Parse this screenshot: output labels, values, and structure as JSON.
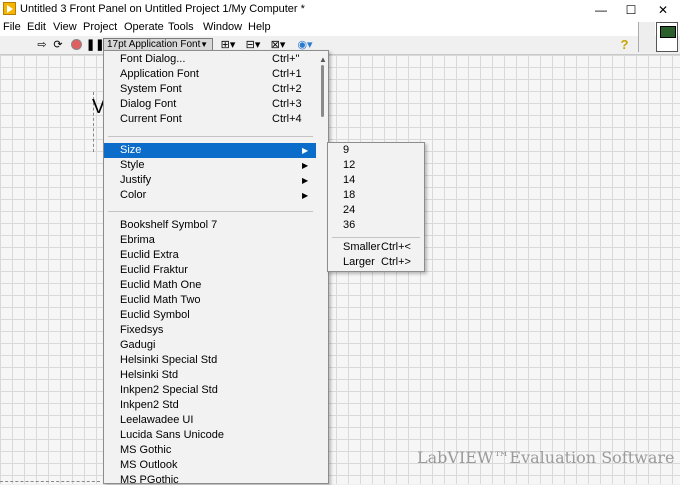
{
  "window": {
    "title": "Untitled 3 Front Panel on Untitled Project 1/My Computer *",
    "min": "—",
    "max": "☐",
    "close": "✕"
  },
  "menubar": [
    "File",
    "Edit",
    "View",
    "Project",
    "Operate",
    "Tools",
    "Window",
    "Help"
  ],
  "toolbar": {
    "font_ring": "17pt Application Font",
    "icons": [
      "run-arrow-icon",
      "run-continuously-icon",
      "abort-icon",
      "pause-icon",
      "align-icon",
      "distribute-icon",
      "resize-icon",
      "reorder-icon",
      "help-icon"
    ]
  },
  "font_menu": {
    "top_items": [
      {
        "label": "Font Dialog...",
        "shortcut": "Ctrl+\""
      },
      {
        "label": "Application Font",
        "shortcut": "Ctrl+1"
      },
      {
        "label": "System Font",
        "shortcut": "Ctrl+2"
      },
      {
        "label": "Dialog Font",
        "shortcut": "Ctrl+3"
      },
      {
        "label": "Current Font",
        "shortcut": "Ctrl+4"
      }
    ],
    "sub_items": [
      {
        "label": "Size",
        "selected": true
      },
      {
        "label": "Style"
      },
      {
        "label": "Justify"
      },
      {
        "label": "Color"
      }
    ],
    "fonts": [
      "Bookshelf Symbol 7",
      "Ebrima",
      "Euclid Extra",
      "Euclid Fraktur",
      "Euclid Math One",
      "Euclid Math Two",
      "Euclid Symbol",
      "Fixedsys",
      "Gadugi",
      "Helsinki Special Std",
      "Helsinki Std",
      "Inkpen2 Special Std",
      "Inkpen2 Std",
      "Leelawadee UI",
      "Lucida Sans Unicode",
      "MS Gothic",
      "MS Outlook",
      "MS PGothic"
    ]
  },
  "size_submenu": {
    "sizes": [
      "9",
      "12",
      "14",
      "18",
      "24",
      "36"
    ],
    "smaller": {
      "label": "Smaller",
      "shortcut": "Ctrl+<"
    },
    "larger": {
      "label": "Larger",
      "shortcut": "Ctrl+>"
    }
  },
  "canvas": {
    "stub_letter": "V",
    "watermark": "LabVIEW™Evaluation Software"
  },
  "colors": {
    "selection": "#0b6dc9",
    "menu_bg": "#f2f2f2",
    "app_icon": "#f5b400"
  }
}
